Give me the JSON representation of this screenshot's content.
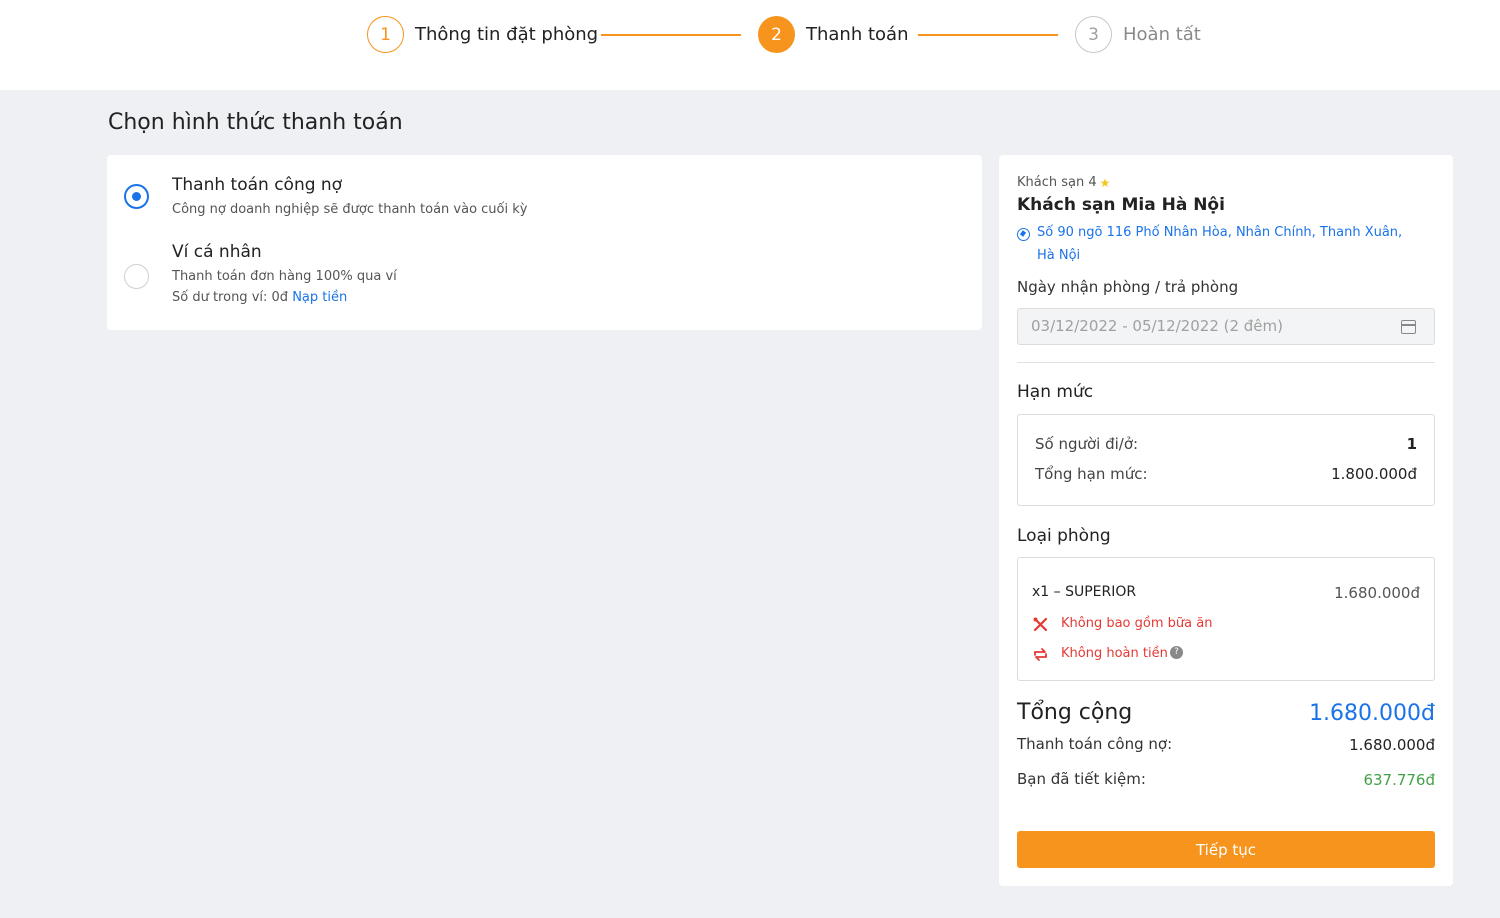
{
  "stepper": {
    "steps": [
      {
        "number": "1",
        "label": "Thông tin đặt phòng",
        "state": "done"
      },
      {
        "number": "2",
        "label": "Thanh toán",
        "state": "active"
      },
      {
        "number": "3",
        "label": "Hoàn tất",
        "state": "pending"
      }
    ]
  },
  "payment": {
    "title": "Chọn hình thức thanh toán",
    "options": [
      {
        "title": "Thanh toán công nợ",
        "desc": "Công nợ doanh nghiệp sẽ được thanh toán vào cuối kỳ",
        "selected": true
      },
      {
        "title": "Ví cá nhân",
        "desc": "Thanh toán đơn hàng 100% qua ví",
        "balance_label": "Số dư trong ví: 0đ",
        "topup_link": "Nạp tiền",
        "selected": false
      }
    ]
  },
  "summary": {
    "hotel_type": "Khách sạn 4",
    "hotel_name": "Khách sạn Mia Hà Nội",
    "address": "Số 90 ngõ 116 Phố Nhân Hòa, Nhân Chính, Thanh Xuân, Hà Nội",
    "date_label": "Ngày nhận phòng / trả phòng",
    "date_value": "03/12/2022 - 05/12/2022 (2 đêm)",
    "limit": {
      "title": "Hạn mức",
      "people_label": "Số người đi/ở:",
      "people_value": "1",
      "total_label": "Tổng hạn mức:",
      "total_value": "1.800.000đ"
    },
    "room": {
      "title": "Loại phòng",
      "name": "x1 – SUPERIOR",
      "price": "1.680.000đ",
      "no_meal": "Không bao gồm bữa ăn",
      "no_refund": "Không hoàn tiền"
    },
    "total_label": "Tổng cộng",
    "total_value": "1.680.000đ",
    "debt_label": "Thanh toán công nợ:",
    "debt_value": "1.680.000đ",
    "saved_label": "Bạn đã tiết kiệm:",
    "saved_value": "637.776đ",
    "continue_label": "Tiếp tục"
  },
  "colors": {
    "accent": "#f7941d",
    "link": "#1a73e8",
    "warning": "#e53935",
    "savings": "#43a047"
  }
}
